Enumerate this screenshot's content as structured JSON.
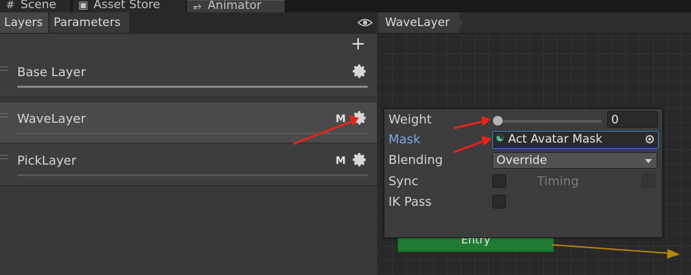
{
  "window_tabs": [
    {
      "label": "Scene",
      "icon": "hash-icon"
    },
    {
      "label": "Asset Store",
      "icon": "store-icon"
    },
    {
      "label": "Animator",
      "icon": "animator-icon"
    }
  ],
  "left_panel": {
    "tabs": [
      "Layers",
      "Parameters"
    ],
    "eye_icon": "eye-icon",
    "add_icon": "plus-icon",
    "layers": [
      {
        "name": "Base Layer",
        "badge": "",
        "icon": "gear-icon"
      },
      {
        "name": "WaveLayer",
        "badge": "M",
        "icon": "gear-icon"
      },
      {
        "name": "PickLayer",
        "badge": "M",
        "icon": "gear-icon"
      }
    ]
  },
  "graph": {
    "breadcrumb": "WaveLayer",
    "entry_label": "Entry",
    "transition_color": "#b8860b"
  },
  "layer_settings": {
    "weight_label": "Weight",
    "weight_value": "0",
    "mask_label": "Mask",
    "mask_value": "Act Avatar Mask",
    "blending_label": "Blending",
    "blending_value": "Override",
    "sync_label": "Sync",
    "timing_label": "Timing",
    "ik_pass_label": "IK Pass"
  },
  "colors": {
    "mask_label": "#7da7e6",
    "entry_node": "#1f7a32",
    "annotation_arrow": "#e8231b"
  }
}
